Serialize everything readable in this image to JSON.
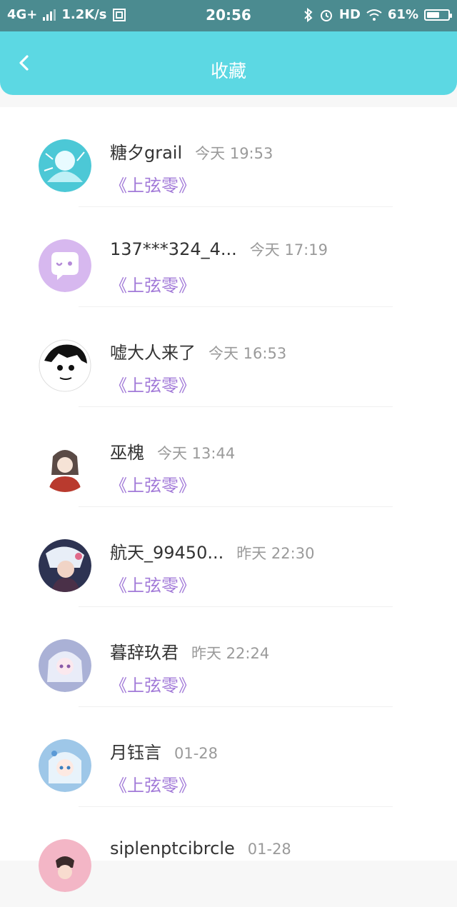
{
  "status_bar": {
    "network": "4G+",
    "speed": "1.2K/s",
    "time": "20:56",
    "hd": "HD",
    "battery": "61%",
    "battery_level": 0.61
  },
  "header": {
    "title": "收藏",
    "back_icon": "back-arrow-icon"
  },
  "favorites": [
    {
      "name": "糖夕grail",
      "time": "今天 19:53",
      "book": "《上弦零》"
    },
    {
      "name": "137***324_4...",
      "time": "今天 17:19",
      "book": "《上弦零》"
    },
    {
      "name": "嘘大人来了",
      "time": "今天 16:53",
      "book": "《上弦零》"
    },
    {
      "name": "巫槐",
      "time": "今天 13:44",
      "book": "《上弦零》"
    },
    {
      "name": "航天_99450...",
      "time": "昨天 22:30",
      "book": "《上弦零》"
    },
    {
      "name": "暮辞玖君",
      "time": "昨天 22:24",
      "book": "《上弦零》"
    },
    {
      "name": "月钰言",
      "time": "01-28",
      "book": "《上弦零》"
    },
    {
      "name": "siplenptcibrcle",
      "time": "01-28",
      "book": ""
    }
  ],
  "colors": {
    "status_bar": "#4b8b90",
    "header": "#5cd8e3",
    "book_title": "#a27ad8",
    "time": "#9a9a9a"
  }
}
